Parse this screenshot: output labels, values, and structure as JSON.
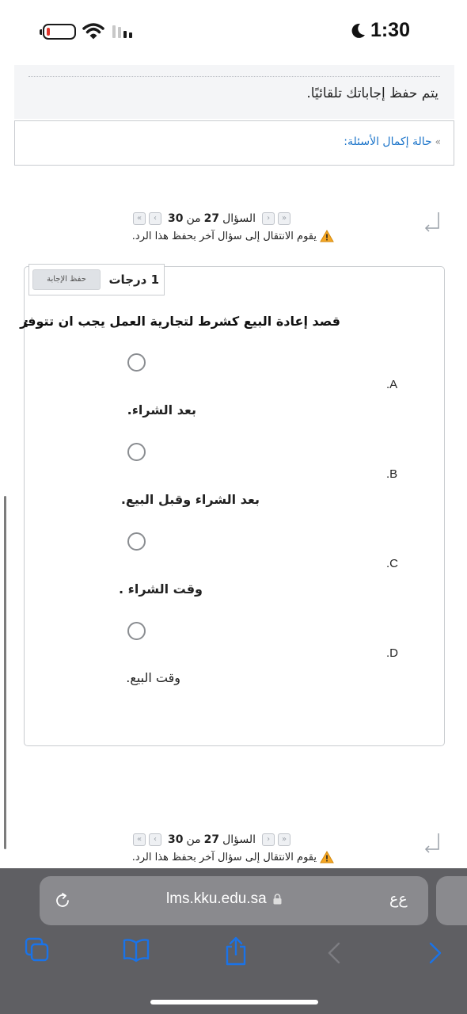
{
  "status_bar": {
    "time": "1:30",
    "icons": [
      "battery-icon",
      "wifi-icon",
      "signal-icon",
      "moon-icon"
    ]
  },
  "quiz": {
    "autosave_text": "يتم حفظ إجاباتك تلقائيًا.",
    "completion_link": "حالة إكمال الأسئلة:",
    "nav_top": {
      "question_label": "السؤال",
      "current": "27",
      "of_label": "من",
      "total": "30",
      "warning": "يقوم الانتقال إلى سؤال آخر بحفظ هذا الرد."
    },
    "nav_bottom": {
      "question_label": "السؤال",
      "current": "27",
      "of_label": "من",
      "total": "30",
      "warning": "يقوم الانتقال إلى سؤال آخر بحفظ هذا الرد."
    },
    "question": {
      "grade": "1 درجات",
      "save_button": "حفظ الإجابة",
      "text": "قصد إعادة البيع كشرط لتجارية العمل يجب ان تتوفر",
      "colon": ":",
      "options": [
        {
          "letter": ".A",
          "text": "بعد الشراء."
        },
        {
          "letter": ".B",
          "text": "بعد الشراء وقبل البيع."
        },
        {
          "letter": ".C",
          "text": "وقت الشراء ."
        },
        {
          "letter": ".D",
          "text": "وقت البيع."
        }
      ]
    }
  },
  "browser": {
    "url": "lms.kku.edu.sa",
    "aa_label": "ﻉﻉ",
    "accent_color": "#1a73e8",
    "toolbar_icons": [
      "tabs-icon",
      "bookmarks-icon",
      "share-icon",
      "back-icon",
      "forward-icon"
    ]
  }
}
